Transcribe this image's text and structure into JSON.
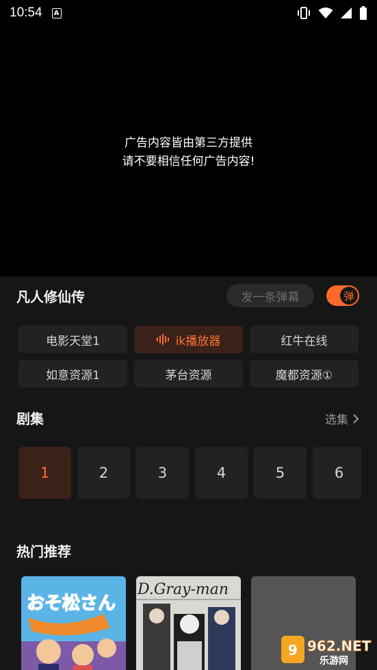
{
  "status_bar": {
    "time": "10:54",
    "notification_letter": "A"
  },
  "player": {
    "ad_line_1": "广告内容皆由第三方提供",
    "ad_line_2": "请不要相信任何广告内容!"
  },
  "details": {
    "title": "凡人修仙传",
    "danmu_placeholder": "发一条弹幕",
    "danmu_toggle_label": "弹",
    "danmu_enabled": true
  },
  "sources": [
    {
      "label": "电影天堂1",
      "active": false
    },
    {
      "label": "ik播放器",
      "active": true
    },
    {
      "label": "红牛在线",
      "active": false
    },
    {
      "label": "如意资源1",
      "active": false
    },
    {
      "label": "茅台资源",
      "active": false
    },
    {
      "label": "魔都资源①",
      "active": false
    }
  ],
  "episodes_section": {
    "title": "剧集",
    "select_label": "选集",
    "items": [
      "1",
      "2",
      "3",
      "4",
      "5",
      "6"
    ],
    "active_index": 0
  },
  "hot_section": {
    "title": "热门推荐",
    "posters": [
      {
        "title_art": "おそ松さん"
      },
      {
        "title_art": "D.Gray-man"
      },
      {
        "title_art": ""
      }
    ]
  },
  "watermark": {
    "brand": "962.NET",
    "subtitle": "乐游网"
  },
  "colors": {
    "accent": "#ff6a2a",
    "background": "#161616",
    "chip": "#222222"
  }
}
